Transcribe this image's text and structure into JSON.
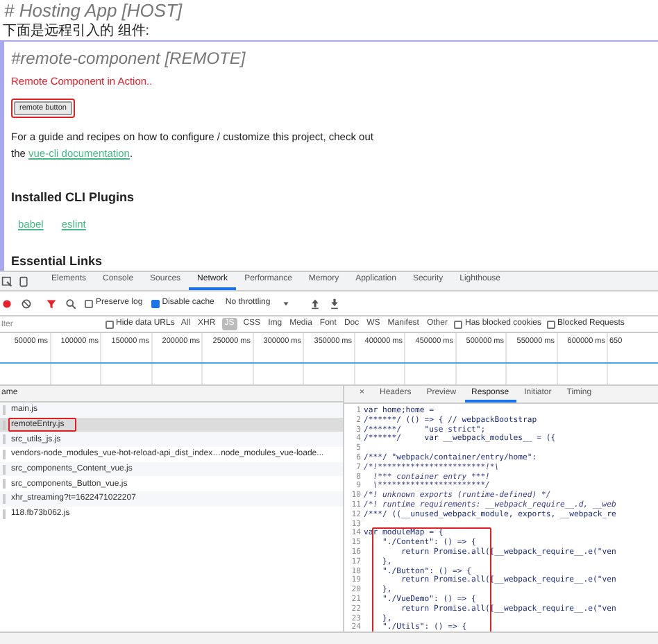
{
  "page": {
    "title": "# Hosting App [HOST]",
    "subtitle": "下面是远程引入的 组件:",
    "remote": {
      "heading": "#remote-component [REMOTE]",
      "notice": "Remote Component in Action..",
      "button": "remote button",
      "highlighted": true,
      "paragraph": {
        "before": "For a guide and recipes on how to configure / customize this project, check out the ",
        "link": "vue-cli documentation",
        "after": "."
      },
      "plugins_heading": "Installed CLI Plugins",
      "plugins": [
        "babel",
        "eslint"
      ],
      "links_heading": "Essential Links"
    }
  },
  "devtools": {
    "panels": [
      {
        "label": "Elements",
        "selected": false
      },
      {
        "label": "Console",
        "selected": false
      },
      {
        "label": "Sources",
        "selected": false
      },
      {
        "label": "Network",
        "selected": true
      },
      {
        "label": "Performance",
        "selected": false
      },
      {
        "label": "Memory",
        "selected": false
      },
      {
        "label": "Application",
        "selected": false
      },
      {
        "label": "Security",
        "selected": false
      },
      {
        "label": "Lighthouse",
        "selected": false
      }
    ],
    "toolbar": {
      "preserve_log": {
        "label": "Preserve log",
        "checked": false
      },
      "disable_cache": {
        "label": "Disable cache",
        "checked": true
      },
      "throttling": "No throttling"
    },
    "filter": {
      "placeholder": "lter",
      "hide_data_urls": {
        "label": "Hide data URLs",
        "checked": false
      },
      "types": [
        {
          "label": "All",
          "selected": false
        },
        {
          "label": "XHR",
          "selected": false
        },
        {
          "label": "JS",
          "selected": true
        },
        {
          "label": "CSS",
          "selected": false
        },
        {
          "label": "Img",
          "selected": false
        },
        {
          "label": "Media",
          "selected": false
        },
        {
          "label": "Font",
          "selected": false
        },
        {
          "label": "Doc",
          "selected": false
        },
        {
          "label": "WS",
          "selected": false
        },
        {
          "label": "Manifest",
          "selected": false
        },
        {
          "label": "Other",
          "selected": false
        }
      ],
      "has_blocked_cookies": {
        "label": "Has blocked cookies",
        "checked": false
      },
      "blocked_requests": {
        "label": "Blocked Requests",
        "checked": false
      }
    },
    "timeline": [
      "50000 ms",
      "100000 ms",
      "150000 ms",
      "200000 ms",
      "250000 ms",
      "300000 ms",
      "350000 ms",
      "400000 ms",
      "450000 ms",
      "500000 ms",
      "550000 ms",
      "600000 ms",
      "650"
    ],
    "requests": {
      "column": "ame",
      "rows": [
        {
          "name": "main.js",
          "selected": false,
          "highlighted": false
        },
        {
          "name": "remoteEntry.js",
          "selected": true,
          "highlighted": true
        },
        {
          "name": "src_utils_js.js",
          "selected": false,
          "highlighted": false
        },
        {
          "name": "vendors-node_modules_vue-hot-reload-api_dist_index…node_modules_vue-loade...",
          "selected": false,
          "highlighted": false
        },
        {
          "name": "src_components_Content_vue.js",
          "selected": false,
          "highlighted": false
        },
        {
          "name": "src_components_Button_vue.js",
          "selected": false,
          "highlighted": false
        },
        {
          "name": "xhr_streaming?t=1622471022207",
          "selected": false,
          "highlighted": false
        },
        {
          "name": "118.fb73b062.js",
          "selected": false,
          "highlighted": false
        }
      ]
    },
    "detail_tabs": [
      {
        "label": "×",
        "selected": false
      },
      {
        "label": "Headers",
        "selected": false
      },
      {
        "label": "Preview",
        "selected": false
      },
      {
        "label": "Response",
        "selected": true
      },
      {
        "label": "Initiator",
        "selected": false
      },
      {
        "label": "Timing",
        "selected": false
      }
    ],
    "code": [
      {
        "n": "1",
        "text": "var home;home =",
        "kind": "code"
      },
      {
        "n": "2",
        "text": "/******/ (() => { // webpackBootstrap",
        "kind": "code"
      },
      {
        "n": "3",
        "text": "/******/     \"use strict\";",
        "kind": "code"
      },
      {
        "n": "4",
        "text": "/******/     var __webpack_modules__ = ({",
        "kind": "code"
      },
      {
        "n": "5",
        "kind": "blank"
      },
      {
        "n": "6",
        "text": "/***/ \"webpack/container/entry/home\":",
        "kind": "code"
      },
      {
        "n": "7",
        "text": "/*!***********************!*\\",
        "kind": "comment"
      },
      {
        "n": "8",
        "text": "  !*** container entry ***!",
        "kind": "comment"
      },
      {
        "n": "9",
        "text": "  \\***********************/",
        "kind": "comment"
      },
      {
        "n": "10",
        "text": "/*! unknown exports (runtime-defined) */",
        "kind": "comment"
      },
      {
        "n": "11",
        "text": "/*! runtime requirements: __webpack_require__.d, __web",
        "kind": "comment"
      },
      {
        "n": "12",
        "text": "/***/ ((__unused_webpack_module, exports, __webpack_re",
        "kind": "code"
      },
      {
        "n": "13",
        "kind": "blank"
      }
    ],
    "framed_code": [
      {
        "n": "14",
        "text": "var moduleMap = {",
        "kind": "code"
      },
      {
        "n": "15",
        "text": "    \"./Content\": () => {",
        "kind": "code"
      },
      {
        "n": "16",
        "text": "        return Promise.all([__webpack_require__.e(\"ven",
        "kind": "code"
      },
      {
        "n": "17",
        "text": "    },",
        "kind": "code"
      },
      {
        "n": "18",
        "text": "    \"./Button\": () => {",
        "kind": "code"
      },
      {
        "n": "19",
        "text": "        return Promise.all([__webpack_require__.e(\"ven",
        "kind": "code"
      },
      {
        "n": "20",
        "text": "    },",
        "kind": "code"
      },
      {
        "n": "21",
        "text": "    \"./VueDemo\": () => {",
        "kind": "code"
      },
      {
        "n": "22",
        "text": "        return Promise.all([__webpack_require__.e(\"ven",
        "kind": "code"
      },
      {
        "n": "23",
        "text": "    },",
        "kind": "code"
      },
      {
        "n": "24",
        "text": "    \"./Utils\": () => {",
        "kind": "code"
      }
    ]
  }
}
